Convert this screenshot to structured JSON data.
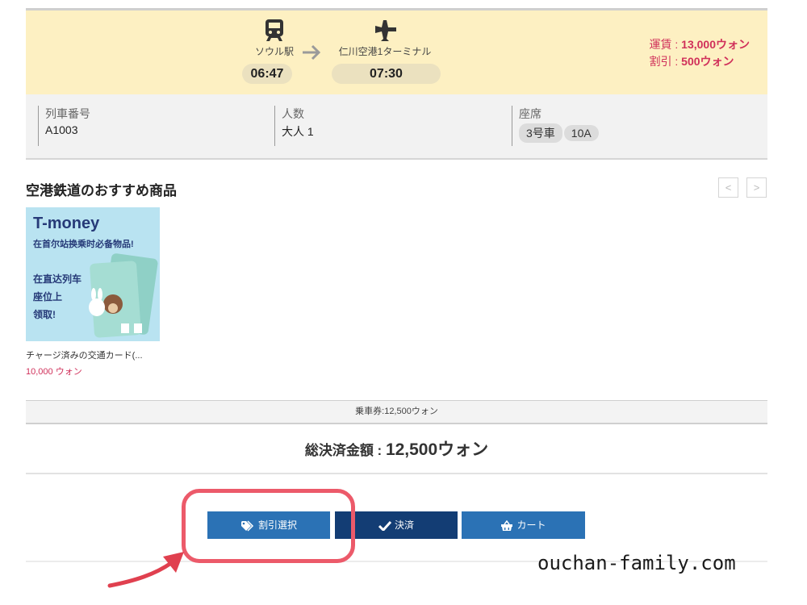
{
  "route": {
    "origin": {
      "name": "ソウル駅",
      "time": "06:47",
      "icon": "train-icon"
    },
    "destination": {
      "name": "仁川空港1ターミナル",
      "time": "07:30",
      "icon": "airplane-icon"
    },
    "arrow_icon": "arrow-right-icon",
    "fare_label": "運賃 : ",
    "fare_value": "13,000ウォン",
    "discount_label": "割引 : ",
    "discount_value": "500ウォン"
  },
  "info": {
    "train_no_label": "列車番号",
    "train_no_value": "A1003",
    "people_label": "人数",
    "people_value": "大人 1",
    "seat_label": "座席",
    "seat_car": "3号車",
    "seat_no": "10A"
  },
  "recommend": {
    "title": "空港鉄道のおすすめ商品",
    "prev_label": "<",
    "next_label": ">",
    "products": [
      {
        "img_title": "T-money",
        "img_sub": "在首尔站换乘时必备物品!",
        "img_body": [
          "在直达列车",
          "座位上",
          "领取!"
        ],
        "name": "チャージ済みの交通カード(...",
        "price": "10,000 ウォン"
      }
    ]
  },
  "summary": {
    "ticket_line": "乗車券:12,500ウォン",
    "total_label": "総決済金額 : ",
    "total_value": "12,500ウォン"
  },
  "actions": {
    "discount_label": "割引選択",
    "pay_label": "決済",
    "cart_label": "カート"
  },
  "watermark": "ouchan-family.com",
  "colors": {
    "accent_pink": "#d0305a",
    "primary_blue": "#2b72b5",
    "dark_blue": "#133d74",
    "highlight_red": "#ec5a6a",
    "route_bg": "#fdf0c2"
  }
}
